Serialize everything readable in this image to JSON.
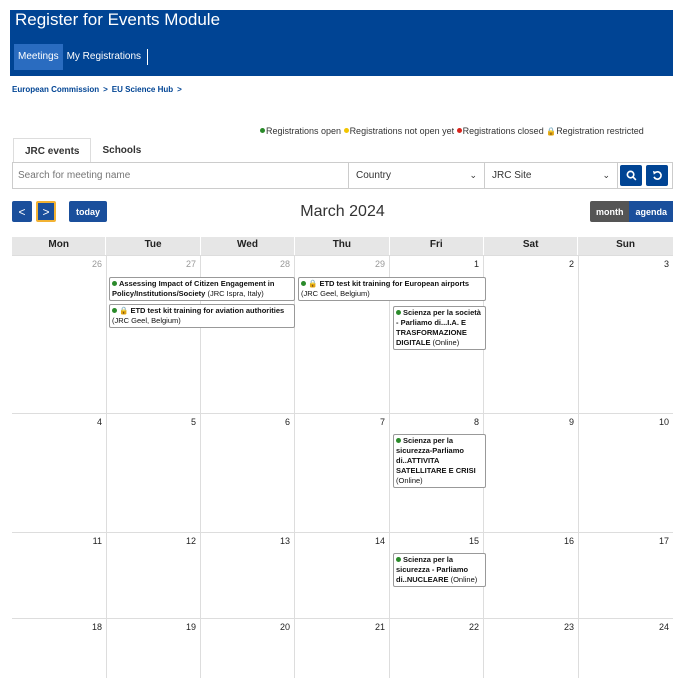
{
  "header": {
    "app_title": "Register for Events Module",
    "nav": [
      {
        "label": "Meetings"
      },
      {
        "label": "My Registrations"
      }
    ]
  },
  "breadcrumb": [
    {
      "label": "European Commission"
    },
    {
      "label": "EU Science Hub"
    }
  ],
  "breadcrumb_sep": ">",
  "legend": {
    "open": "Registrations open",
    "not_open": "Registrations not open yet",
    "closed": "Registrations closed",
    "restricted": "Registration restricted",
    "colors": {
      "open": "#2a8a2a",
      "not_open": "#f2c500",
      "closed": "#d9251d"
    }
  },
  "tabs": [
    {
      "label": "JRC events"
    },
    {
      "label": "Schools"
    }
  ],
  "filters": {
    "search_placeholder": "Search for meeting name",
    "country": "Country",
    "site": "JRC Site"
  },
  "toolbar": {
    "prev": "<",
    "next": ">",
    "today": "today",
    "month_title": "March 2024",
    "month": "month",
    "agenda": "agenda"
  },
  "calendar": {
    "days": [
      "Mon",
      "Tue",
      "Wed",
      "Thu",
      "Fri",
      "Sat",
      "Sun"
    ],
    "weeks": [
      [
        "26",
        "27",
        "28",
        "29",
        "1",
        "2",
        "3"
      ],
      [
        "4",
        "5",
        "6",
        "7",
        "8",
        "9",
        "10"
      ],
      [
        "11",
        "12",
        "13",
        "14",
        "15",
        "16",
        "17"
      ],
      [
        "18",
        "19",
        "20",
        "21",
        "22",
        "23",
        "24"
      ]
    ]
  },
  "events": [
    {
      "title": "Assessing Impact of Citizen Engagement in Policy/Institutions/Society",
      "location": "(JRC Ispra, Italy)",
      "status": "open",
      "restricted": false
    },
    {
      "title": "ETD test kit training for aviation authorities",
      "location": "(JRC Geel, Belgium)",
      "status": "open",
      "restricted": true
    },
    {
      "title": "ETD test kit training for European airports",
      "location": "(JRC Geel, Belgium)",
      "status": "open",
      "restricted": true
    },
    {
      "title": "Scienza per la società - Parliamo di...I.A. E TRASFORMAZIONE DIGITALE",
      "location": "(Online)",
      "status": "open",
      "restricted": false
    },
    {
      "title": "Scienza per la sicurezza-Parliamo di..ATTIVITA SATELLITARE E CRISI",
      "location": "(Online)",
      "status": "open",
      "restricted": false
    },
    {
      "title": "Scienza per la sicurezza - Parliamo di..NUCLEARE",
      "location": "(Online)",
      "status": "open",
      "restricted": false
    }
  ]
}
